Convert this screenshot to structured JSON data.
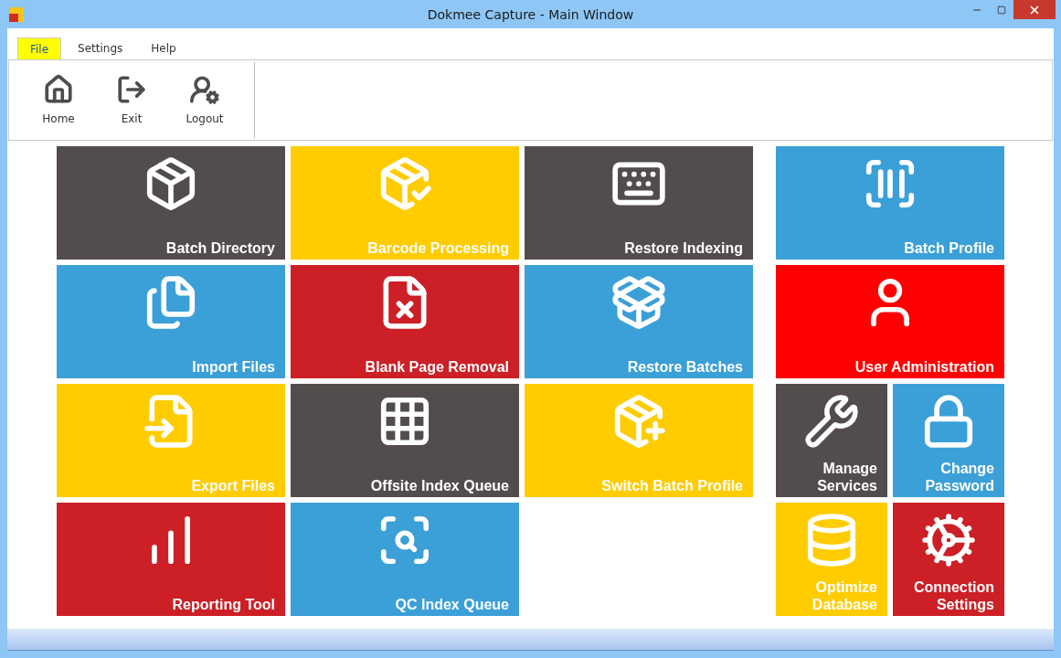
{
  "window": {
    "title": "Dokmee Capture - Main Window"
  },
  "menu_tabs": [
    {
      "label": "File",
      "selected": true
    },
    {
      "label": "Settings",
      "selected": false
    },
    {
      "label": "Help",
      "selected": false
    }
  ],
  "ribbon": [
    {
      "label": "Home"
    },
    {
      "label": "Exit"
    },
    {
      "label": "Logout"
    }
  ],
  "tiles": [
    {
      "label": "Batch Directory",
      "color": "#524d4c"
    },
    {
      "label": "Barcode Processing",
      "color": "#ffcc00"
    },
    {
      "label": "Restore Indexing",
      "color": "#524d4c"
    },
    {
      "label": "Import Files",
      "color": "#3b9fd8"
    },
    {
      "label": "Blank Page Removal",
      "color": "#cc1f26"
    },
    {
      "label": "Restore Batches",
      "color": "#3b9fd8"
    },
    {
      "label": "Export Files",
      "color": "#ffcc00"
    },
    {
      "label": "Offsite Index Queue",
      "color": "#524d4c"
    },
    {
      "label": "Switch Batch Profile",
      "color": "#ffcc00"
    },
    {
      "label": "Reporting Tool",
      "color": "#cc1f26"
    },
    {
      "label": "QC Index Queue",
      "color": "#3b9fd8"
    }
  ],
  "admin_tiles": [
    {
      "label": "Batch Profile",
      "color": "#3b9fd8",
      "kind": "wide"
    },
    {
      "label": "User Administration",
      "color": "#ff0000",
      "kind": "wide"
    },
    {
      "label": "Manage Services",
      "color": "#524d4c",
      "kind": "small"
    },
    {
      "label": "Change Password",
      "color": "#3b9fd8",
      "kind": "small"
    },
    {
      "label": "Optimize Database",
      "color": "#ffcc00",
      "kind": "small"
    },
    {
      "label": "Connection Settings",
      "color": "#cc1f26",
      "kind": "small"
    }
  ]
}
